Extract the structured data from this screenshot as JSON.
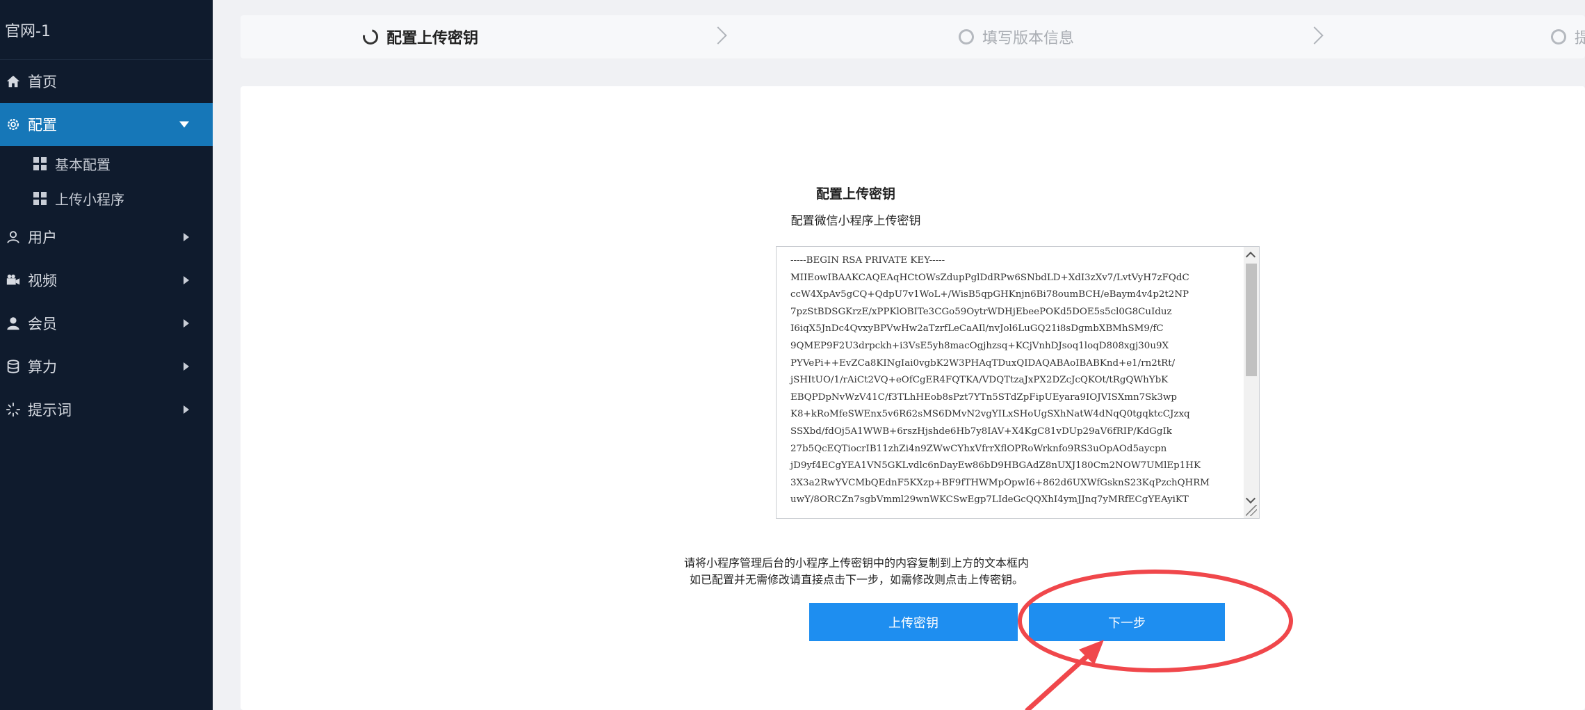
{
  "sidebar": {
    "brand": "官网-1",
    "items": [
      {
        "label": "首页",
        "icon": "home-icon"
      },
      {
        "label": "配置",
        "icon": "gear-icon",
        "active": true
      },
      {
        "label": "用户",
        "icon": "user-outline-icon"
      },
      {
        "label": "视频",
        "icon": "video-camera-icon"
      },
      {
        "label": "会员",
        "icon": "user-solid-icon"
      },
      {
        "label": "算力",
        "icon": "database-icon"
      },
      {
        "label": "提示词",
        "icon": "spinner-icon"
      }
    ],
    "sub_items": [
      {
        "label": "基本配置",
        "icon": "grid-icon"
      },
      {
        "label": "上传小程序",
        "icon": "grid-icon"
      }
    ]
  },
  "steps": [
    {
      "label": "配置上传密钥",
      "state": "active"
    },
    {
      "label": "填写版本信息",
      "state": "inactive"
    },
    {
      "label": "提",
      "state": "inactive"
    }
  ],
  "main": {
    "title": "配置上传密钥",
    "subtitle": "配置微信小程序上传密钥",
    "key_text": "-----BEGIN RSA PRIVATE KEY-----\nMIIEowIBAAKCAQEAqHCtOWsZdupPglDdRPw6SNbdLD+XdI3zXv7/LvtVyH7zFQdC\nccW4XpAv5gCQ+QdpU7v1WoL+/WisB5qpGHKnjn6Bi78oumBCH/eBaym4v4p2t2NP\n7pzStBDSGKrzE/xPPKlOBITe3CGo59OytrWDHjEbeePOKd5DOE5s5cl0G8CuIduz\nI6iqX5JnDc4QvxyBPVwHw2aTzrfLeCaAIl/nvJol6LuGQ21i8sDgmbXBMhSM9/fC\n9QMEP9F2U3drpckh+i3VsE5yh8macOgjhzsq+KCjVnhDJsoq1loqD808xgj30u9X\nPYVePi++EvZCa8KINgIai0vgbK2W3PHAqTDuxQIDAQABAoIBABKnd+e1/rn2tRt/\njSHItUO/1/rAiCt2VQ+eOfCgER4FQTKA/VDQTtzaJxPX2DZcJcQKOt/tRgQWhYbK\nEBQPDpNvWzV41C/f3TLhHEob8sPzt7YTn5STdZpFipUEyara9IOJVISXmn7Sk3wp\nK8+kRoMfeSWEnx5v6R62sMS6DMvN2vgYILxSHoUgSXhNatW4dNqQ0tgqktcCJzxq\nSSXbd/fdOj5A1WWB+6rszHjshde6Hb7y8IAV+X4KgC81vDUp29aV6fRIP/KdGgIk\n27b5QcEQTiocrIB11zhZi4n9ZWwCYhxVfrrXflOPRoWrknfo9RS3uOpAOd5aycpn\njD9yf4ECgYEA1VN5GKLvdlc6nDayEw86bD9HBGAdZ8nUXJ180Cm2NOW7UMlEp1HK\n3X3a2RwYVCMbQEdnF5KXzp+BF9fTHWMpOpwI6+862d6UXWfGsknS23KqPzchQHRM\nuwY/8ORCZn7sgbVmml29wnWKCSwEgp7LIdeGcQQXhI4ymJJnq7yMRfECgYEAyiKT"
  },
  "hints": {
    "line1": "请将小程序管理后台的小程序上传密钥中的内容复制到上方的文本框内",
    "line2": "如已配置并无需修改请直接点击下一步，如需修改则点击上传密钥。"
  },
  "buttons": {
    "upload_label": "上传密钥",
    "next_label": "下一步"
  },
  "colors": {
    "sidebar_bg": "#0f1b2d",
    "active_menu": "#1677b8",
    "button": "#1e8ef0",
    "annotation": "#f0474b"
  }
}
